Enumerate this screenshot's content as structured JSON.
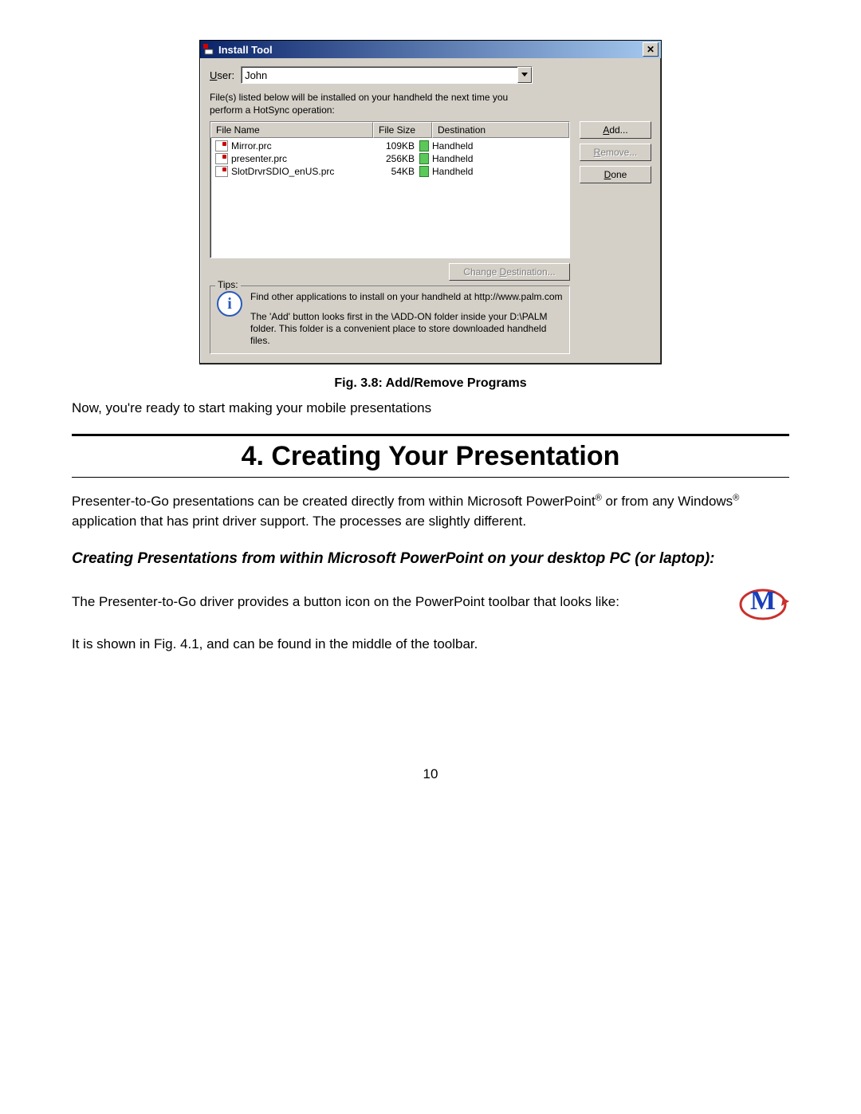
{
  "window": {
    "title": "Install Tool",
    "user_label": "User:",
    "user_value": "John",
    "instruction": "File(s) listed below will be installed on your handheld the next time you perform a HotSync operation:",
    "columns": {
      "filename": "File Name",
      "filesize": "File Size",
      "destination": "Destination"
    },
    "files": [
      {
        "name": "Mirror.prc",
        "size": "109KB",
        "dest": "Handheld"
      },
      {
        "name": "presenter.prc",
        "size": "256KB",
        "dest": "Handheld"
      },
      {
        "name": "SlotDrvrSDIO_enUS.prc",
        "size": "54KB",
        "dest": "Handheld"
      }
    ],
    "buttons": {
      "add": "Add...",
      "remove": "Remove...",
      "done": "Done",
      "change_dest": "Change Destination..."
    },
    "tips_label": "Tips:",
    "tips_p1": "Find other applications to install on your handheld at http://www.palm.com",
    "tips_p2": "The 'Add' button looks first in the \\ADD-ON folder inside your D:\\PALM folder. This folder is a convenient place to store downloaded handheld files."
  },
  "doc": {
    "caption": "Fig. 3.8: Add/Remove Programs",
    "after_caption": "Now, you're ready to start making your mobile presentations",
    "section_title": "4. Creating Your Presentation",
    "para1a": "Presenter-to-Go presentations can be created directly from within Microsoft PowerPoint",
    "para1b": " or from any Windows",
    "para1c": " application that has print driver support.  The processes are slightly different.",
    "subhead": "Creating Presentations from within Microsoft PowerPoint on your desktop PC (or laptop):",
    "para2": "The Presenter-to-Go driver provides a button icon on the PowerPoint toolbar that looks like:",
    "para3": "It is shown in Fig. 4.1, and can be found in the middle of the toolbar.",
    "page_number": "10"
  }
}
